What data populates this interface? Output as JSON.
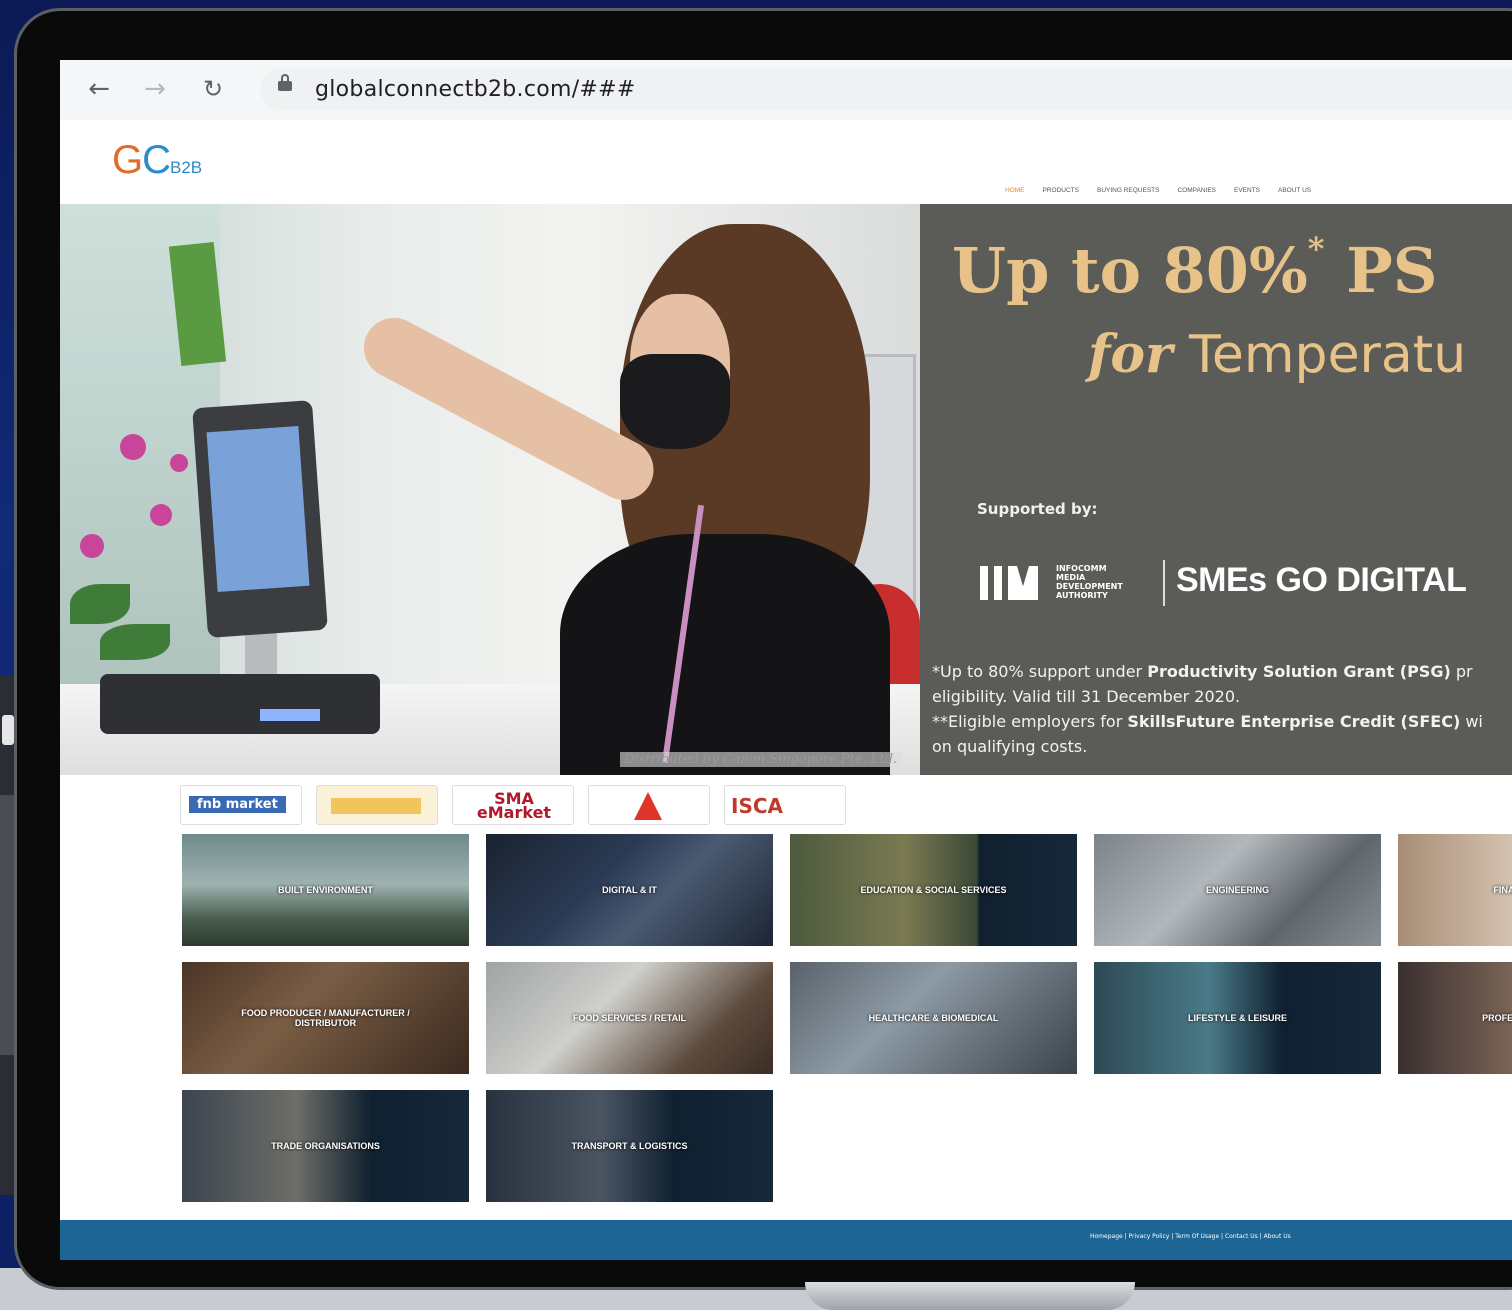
{
  "browser": {
    "url": "globalconnectb2b.com/###"
  },
  "site": {
    "logo": {
      "g": "G",
      "c": "C",
      "b2b": "B2B"
    },
    "nav": [
      "HOME",
      "PRODUCTS",
      "BUYING REQUESTS",
      "COMPANIES",
      "EVENTS",
      "ABOUT US"
    ],
    "active_nav": "HOME"
  },
  "hero": {
    "caption": "Distributed by Canon Singapore Pte. Ltd.",
    "headline": "Up to 80%",
    "headline_mark": "*",
    "headline_rest": " PS",
    "subline_for": "for",
    "subline_rest": " Temperatu",
    "supported_by": "Supported by:",
    "imda_text": "INFOCOMM\nMEDIA\nDEVELOPMENT\nAUTHORITY",
    "smes": "SMEs GO DIGITAL",
    "fine_1a": "*Up to 80% support under ",
    "fine_1b": "Productivity Solution Grant (PSG)",
    "fine_1c": " pr",
    "fine_2": "eligibility. Valid till 31 December 2020.",
    "fine_3a": "**Eligible employers for ",
    "fine_3b": "SkillsFuture Enterprise Credit (SFEC)",
    "fine_3c": " wi",
    "fine_4": "on qualifying costs."
  },
  "partners": [
    "fnb market",
    "",
    "SMA eMarket",
    "",
    "ISCA"
  ],
  "categories": [
    {
      "label": "BUILT ENVIRONMENT",
      "bg": "linear-gradient(180deg,#6f8a8c 0%,#9fb2b0 45%,#4b5e50 75%,#2c3a30 100%)"
    },
    {
      "label": "DIGITAL & IT",
      "bg": "linear-gradient(135deg,#1a2230 0%,#2b3b55 40%,#4b5a72 60%,#1b2533 100%)"
    },
    {
      "label": "EDUCATION & SOCIAL SERVICES",
      "bg": "linear-gradient(90deg,#4d5a3e 0%,#7a7a52 40%,#3b4a38 65%,#10202e 66%,#16283a 100%)"
    },
    {
      "label": "ENGINEERING",
      "bg": "linear-gradient(135deg,#7c8389 0%,#b2b7bb 40%,#5f666c 70%,#8a8f94 100%)"
    },
    {
      "label": "FINANCIAL SERVICES",
      "bg": "linear-gradient(90deg,#a88d76 0%,#d4c2b0 40%,#8b7e78 100%)"
    },
    {
      "label": "FOOD PRODUCER / MANUFACTURER / DISTRIBUTOR",
      "bg": "linear-gradient(135deg,#4b3526 0%,#7a5d44 40%,#3a2a20 100%)"
    },
    {
      "label": "FOOD SERVICES / RETAIL",
      "bg": "linear-gradient(135deg,#9ea3a4 0%,#cfcfcb 40%,#5d4a3d 75%,#3b2d24 100%)"
    },
    {
      "label": "HEALTHCARE & BIOMEDICAL",
      "bg": "linear-gradient(135deg,#59626b 0%,#8d9aa4 40%,#3b434b 100%)"
    },
    {
      "label": "LIFESTYLE & LEISURE",
      "bg": "linear-gradient(90deg,#2d4a55 0%,#4a7a88 40%,#0f2030 66%,#16283a 100%)"
    },
    {
      "label": "PROFESSIONAL SERVICES",
      "bg": "linear-gradient(90deg,#3a3030 0%,#7a6456 40%,#4b3f36 100%)"
    },
    {
      "label": "TRADE ORGANISATIONS",
      "bg": "linear-gradient(90deg,#3b4450 0%,#6d6e67 40%,#0f2030 66%,#16283a 100%)"
    },
    {
      "label": "TRANSPORT & LOGISTICS",
      "bg": "linear-gradient(90deg,#28323e 0%,#4a5562 40%,#0f2030 66%,#16283a 100%)"
    }
  ],
  "footer": {
    "links": "Homepage | Privacy Policy | Term Of Usage | Contact Us | About Us"
  },
  "colors": {
    "promo_gold": "#e7c38a",
    "promo_bg": "#5b5b58",
    "footer_bg": "#1d6594",
    "logo_orange": "#e46a2a",
    "logo_blue": "#2e8bc9"
  }
}
